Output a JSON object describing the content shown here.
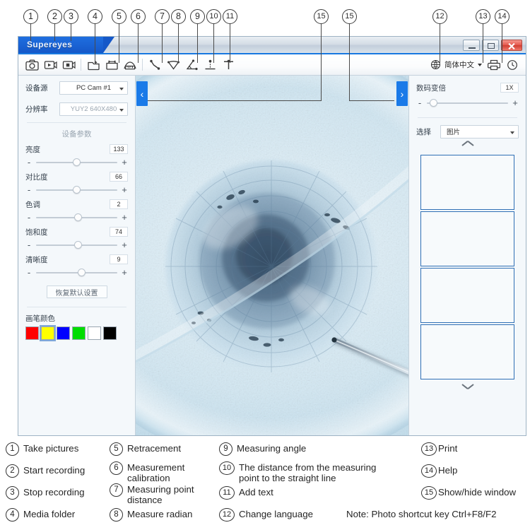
{
  "window": {
    "title": "Supereyes",
    "minimize_label": "Minimize",
    "maximize_label": "Maximize",
    "close_label": "Close"
  },
  "toolbar": {
    "buttons": [
      {
        "name": "take-pictures",
        "icon": "camera-icon"
      },
      {
        "name": "start-recording",
        "icon": "video-play-icon"
      },
      {
        "name": "stop-recording",
        "icon": "video-stop-icon"
      },
      {
        "name": "media-folder",
        "icon": "folder-icon"
      },
      {
        "name": "retracement",
        "icon": "undo-folder-icon"
      },
      {
        "name": "measurement-calibration",
        "icon": "ruler-icon"
      },
      {
        "name": "measuring-point-distance",
        "icon": "point-distance-icon"
      },
      {
        "name": "measure-radian",
        "icon": "radian-icon"
      },
      {
        "name": "measuring-angle",
        "icon": "angle-icon"
      },
      {
        "name": "point-to-line-distance",
        "icon": "point-to-line-icon"
      },
      {
        "name": "add-text",
        "icon": "text-icon"
      }
    ],
    "language": {
      "icon": "globe-icon",
      "value": "简体中文"
    },
    "print": {
      "icon": "printer-icon",
      "label": "Print"
    },
    "help": {
      "icon": "help-clock-icon",
      "label": "Help"
    }
  },
  "left_panel": {
    "device_source": {
      "label": "设备源",
      "value": "PC Cam #1"
    },
    "resolution": {
      "label": "分辨率",
      "value": "YUY2 640X480"
    },
    "section_title": "设备参数",
    "params": [
      {
        "label": "亮度",
        "value": "133",
        "percent": 50
      },
      {
        "label": "对比度",
        "value": "66",
        "percent": 50
      },
      {
        "label": "色调",
        "value": "2",
        "percent": 52
      },
      {
        "label": "饱和度",
        "value": "74",
        "percent": 52
      },
      {
        "label": "清晰度",
        "value": "9",
        "percent": 56
      }
    ],
    "minus_label": "-",
    "plus_label": "+",
    "reset_label": "恢复默认设置",
    "pen_color_label": "画笔颜色",
    "pen_colors": [
      "#ff0000",
      "#ffff00",
      "#0000ff",
      "#00dd00",
      "#ffffff",
      "#000000"
    ],
    "pen_color_selected_index": 1
  },
  "right_panel": {
    "zoom": {
      "label": "数码变倍",
      "value": "1X",
      "percent": 8
    },
    "minus_label": "-",
    "plus_label": "+",
    "select": {
      "label": "选择",
      "value": "图片"
    },
    "scroll_up": "scroll-up-icon",
    "scroll_down": "scroll-down-icon",
    "thumbnail_count": 4
  },
  "viewport": {
    "collapse_left": "‹",
    "collapse_right": "›",
    "image_description": "microscope-live-preview"
  },
  "callouts": [
    "1",
    "2",
    "3",
    "4",
    "5",
    "6",
    "7",
    "8",
    "9",
    "10",
    "11",
    "12",
    "13",
    "14",
    "15",
    "15"
  ],
  "legend": {
    "items": [
      {
        "num": "1",
        "text": "Take pictures"
      },
      {
        "num": "2",
        "text": "Start recording"
      },
      {
        "num": "3",
        "text": "Stop recording"
      },
      {
        "num": "4",
        "text": "Media folder"
      },
      {
        "num": "5",
        "text": "Retracement"
      },
      {
        "num": "6",
        "text": "Measurement calibration"
      },
      {
        "num": "7",
        "text": "Measuring point distance"
      },
      {
        "num": "8",
        "text": "Measure radian"
      },
      {
        "num": "9",
        "text": "Measuring angle"
      },
      {
        "num": "10",
        "text": "The distance from the measuring point to the straight line"
      },
      {
        "num": "11",
        "text": "Add text"
      },
      {
        "num": "12",
        "text": "Change language"
      },
      {
        "num": "13",
        "text": "Print"
      },
      {
        "num": "14",
        "text": "Help"
      },
      {
        "num": "15",
        "text": "Show/hide window"
      }
    ],
    "note": "Note: Photo shortcut key Ctrl+F8/F2"
  },
  "colors": {
    "accent": "#1a7ae8",
    "title_tab": "#1558c8",
    "panel_bg": "#f4f8fb",
    "thumb_border": "#2f6fb5",
    "close_red": "#cf3d31"
  }
}
